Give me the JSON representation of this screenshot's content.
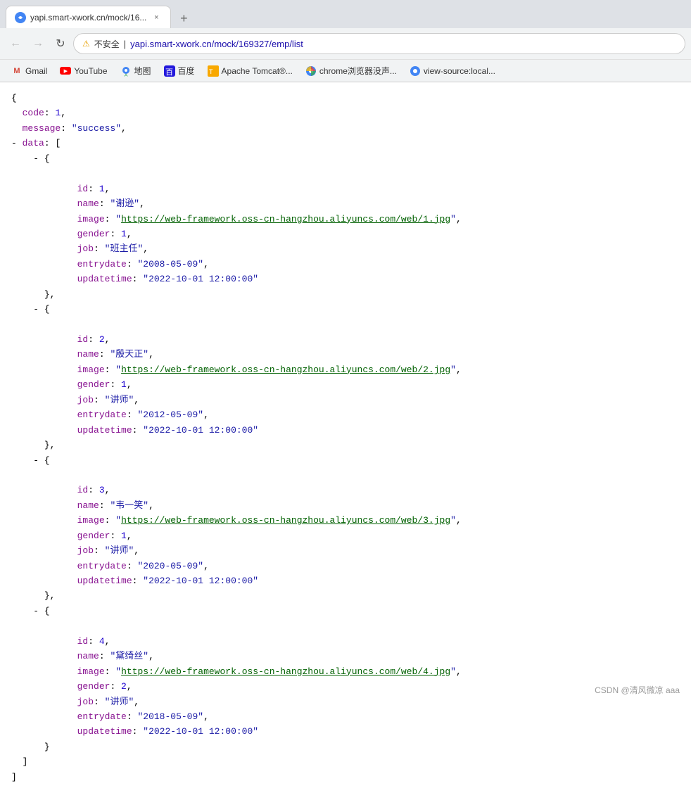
{
  "browser": {
    "tab": {
      "favicon": "◉",
      "title": "yapi.smart-xwork.cn/mock/16...",
      "close_label": "×"
    },
    "new_tab_label": "+",
    "nav": {
      "back_label": "←",
      "forward_label": "→",
      "reload_label": "↻",
      "lock_label": "⚠",
      "insecure_label": "不安全",
      "separator": "|",
      "address": "yapi.smart-xwork.cn/mock/169327/emp/list"
    },
    "bookmarks": [
      {
        "id": "gmail",
        "icon_type": "gmail",
        "label": "Gmail"
      },
      {
        "id": "youtube",
        "icon_type": "youtube",
        "label": "YouTube"
      },
      {
        "id": "maps",
        "icon_type": "maps",
        "label": "地图"
      },
      {
        "id": "baidu",
        "icon_type": "baidu",
        "label": "百度"
      },
      {
        "id": "tomcat",
        "icon_type": "tomcat",
        "label": "Apache Tomcat®..."
      },
      {
        "id": "chrome",
        "icon_type": "chrome",
        "label": "chrome浏览器没声..."
      },
      {
        "id": "viewsource",
        "icon_type": "viewsource",
        "label": "view-source:local..."
      }
    ]
  },
  "json_response": {
    "raw": ""
  },
  "employees": [
    {
      "id": "1",
      "name": "谢逊",
      "image_url": "https://web-framework.oss-cn-hangzhou.aliyuncs.com/web/1.jpg",
      "gender": "1",
      "job": "班主任",
      "entrydate": "2008-05-09",
      "updatetime": "2022-10-01 12:00:00"
    },
    {
      "id": "2",
      "name": "殷天正",
      "image_url": "https://web-framework.oss-cn-hangzhou.aliyuncs.com/web/2.jpg",
      "gender": "1",
      "job": "讲师",
      "entrydate": "2012-05-09",
      "updatetime": "2022-10-01 12:00:00"
    },
    {
      "id": "3",
      "name": "韦一笑",
      "image_url": "https://web-framework.oss-cn-hangzhou.aliyuncs.com/web/3.jpg",
      "gender": "1",
      "job": "讲师",
      "entrydate": "2020-05-09",
      "updatetime": "2022-10-01 12:00:00"
    },
    {
      "id": "4",
      "name": "黛绮丝",
      "image_url": "https://web-framework.oss-cn-hangzhou.aliyuncs.com/web/4.jpg",
      "gender": "2",
      "job": "讲师",
      "entrydate": "2018-05-09",
      "updatetime": "2022-10-01 12:00:00"
    }
  ],
  "watermark": "CSDN @清风微凉 aaa"
}
